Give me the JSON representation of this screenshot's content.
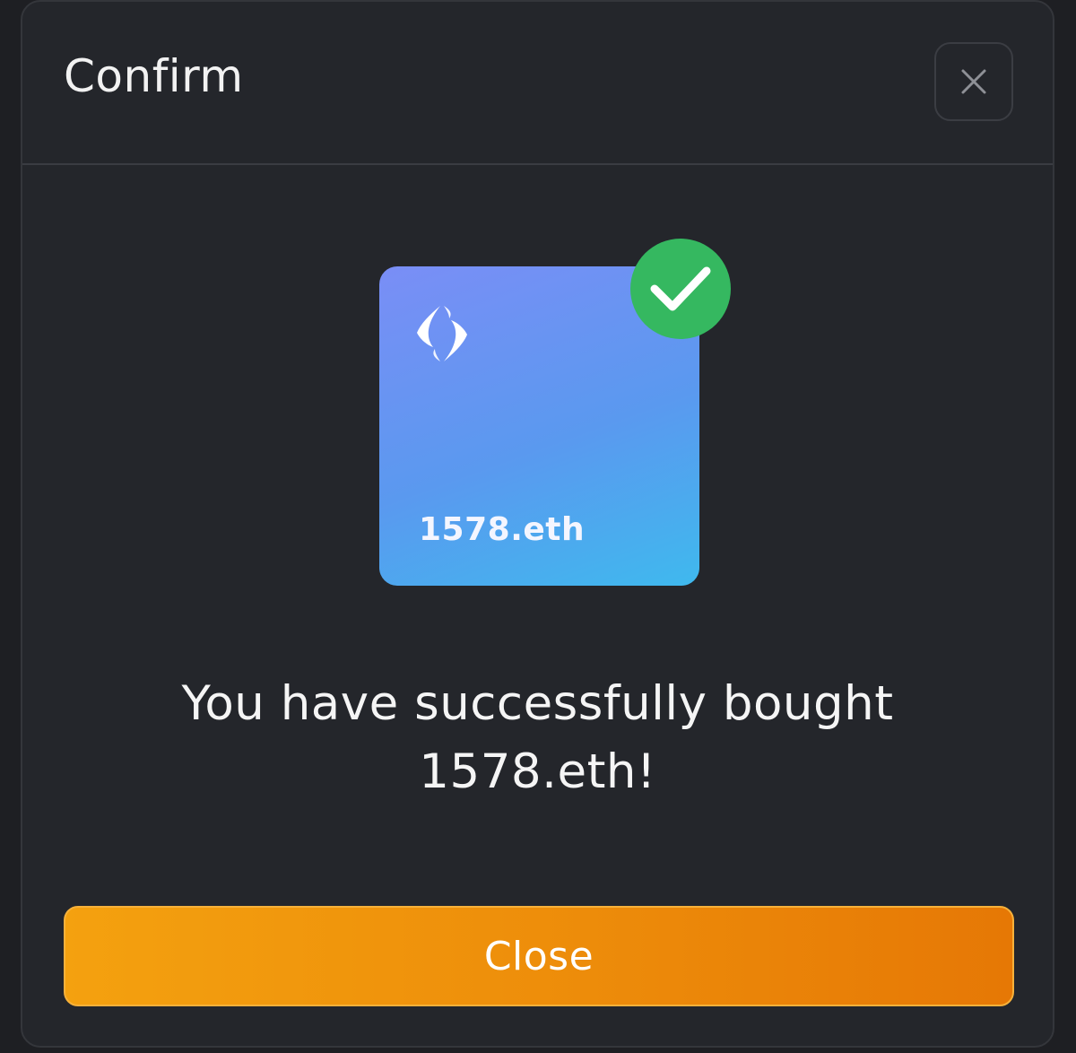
{
  "modal": {
    "title": "Confirm",
    "close_icon": "close-icon"
  },
  "nft": {
    "logo_icon": "ens-logo-icon",
    "name": "1578.eth",
    "badge_icon": "checkmark-icon",
    "gradient": [
      "#7a8ef6",
      "#5a99ef",
      "#3fb9ee"
    ]
  },
  "message": {
    "line1": "You have successfully bought",
    "line2": "1578.eth!"
  },
  "actions": {
    "close_label": "Close"
  },
  "colors": {
    "background": "#24262b",
    "success_green": "#35b860",
    "accent_orange": "#ed8c0a"
  }
}
